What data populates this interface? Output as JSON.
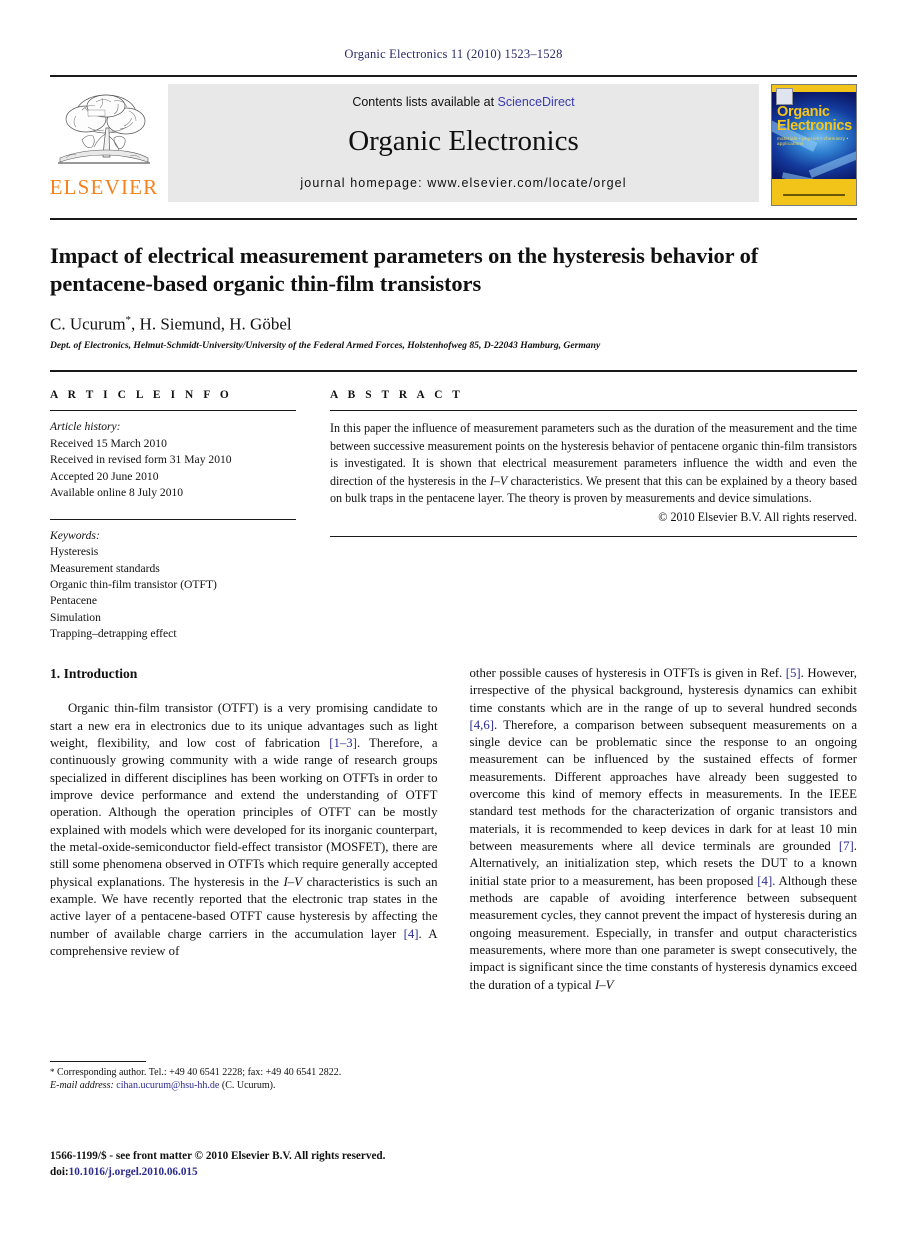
{
  "running_head": "Organic Electronics 11 (2010) 1523–1528",
  "masthead": {
    "publisher_name": "ELSEVIER",
    "contents_prefix": "Contents lists available at ",
    "sciencedirect": "ScienceDirect",
    "journal_title": "Organic Electronics",
    "homepage": "journal homepage: www.elsevier.com/locate/orgel",
    "cover": {
      "title_line1": "Organic",
      "title_line2": "Electronics",
      "subtitle": "materials • physics • chemistry • applications"
    }
  },
  "article": {
    "title": "Impact of electrical measurement parameters on the hysteresis behavior of pentacene-based organic thin-film transistors",
    "authors": "C. Ucurum",
    "authors_rest": ", H. Siemund, H. Göbel",
    "author_marker": "*",
    "affiliation": "Dept. of Electronics, Helmut-Schmidt-University/University of the Federal Armed Forces, Holstenhofweg 85, D-22043 Hamburg, Germany"
  },
  "info": {
    "heading": "A R T I C L E  I N F O",
    "history_label": "Article history:",
    "history": [
      "Received 15 March 2010",
      "Received in revised form 31 May 2010",
      "Accepted 20 June 2010",
      "Available online 8 July 2010"
    ],
    "keywords_label": "Keywords:",
    "keywords": [
      "Hysteresis",
      "Measurement standards",
      "Organic thin-film transistor (OTFT)",
      "Pentacene",
      "Simulation",
      "Trapping–detrapping effect"
    ]
  },
  "abstract": {
    "heading": "A B S T R A C T",
    "part1": "In this paper the influence of measurement parameters such as the duration of the measurement and the time between successive measurement points on the hysteresis behavior of pentacene organic thin-film transistors is investigated. It is shown that electrical measurement parameters influence the width and even the direction of the hysteresis in the ",
    "iv": "I–V",
    "part2": " characteristics. We present that this can be explained by a theory based on bulk traps in the pentacene layer. The theory is proven by measurements and device simulations.",
    "copyright": "© 2010 Elsevier B.V. All rights reserved."
  },
  "body": {
    "section_title": "1. Introduction",
    "left": {
      "p1_a": "Organic thin-film transistor (OTFT) is a very promising candidate to start a new era in electronics due to its unique advantages such as light weight, flexibility, and low cost of fabrication ",
      "ref1": "[1–3]",
      "p1_b": ". Therefore, a continuously growing community with a wide range of research groups specialized in different disciplines has been working on OTFTs in order to improve device performance and extend the understanding of OTFT operation. Although the operation principles of OTFT can be mostly explained with models which were developed for its inorganic counterpart, the metal-oxide-semiconductor field-effect transistor (MOSFET), there are still some phenomena observed in OTFTs which require generally accepted physical explanations. The hysteresis in the ",
      "iv1": "I–V",
      "p1_c": " characteristics is such an example. We have recently reported that the electronic trap states in the active layer of a pentacene-based OTFT cause hysteresis by affecting the number of available charge carriers in the accumulation layer ",
      "ref2": "[4]",
      "p1_d": ". A comprehensive review of"
    },
    "right": {
      "p_a": "other possible causes of hysteresis in OTFTs is given in Ref. ",
      "ref1": "[5]",
      "p_b": ". However, irrespective of the physical background, hysteresis dynamics can exhibit time constants which are in the range of up to several hundred seconds ",
      "ref2": "[4,6]",
      "p_c": ". Therefore, a comparison between subsequent measurements on a single device can be problematic since the response to an ongoing measurement can be influenced by the sustained effects of former measurements. Different approaches have already been suggested to overcome this kind of memory effects in measurements. In the IEEE standard test methods for the characterization of organic transistors and materials, it is recommended to keep devices in dark for at least 10 min between measurements where all device terminals are grounded ",
      "ref3": "[7]",
      "p_d": ". Alternatively, an initialization step, which resets the DUT to a known initial state prior to a measurement, has been proposed ",
      "ref4": "[4]",
      "p_e": ". Although these methods are capable of avoiding interference between subsequent measurement cycles, they cannot prevent the impact of hysteresis during an ongoing measurement. Especially, in transfer and output characteristics measurements, where more than one parameter is swept consecutively, the impact is significant since the time constants of hysteresis dynamics exceed the duration of a typical ",
      "iv1": "I–V"
    }
  },
  "footnote": {
    "marker": "*",
    "text": " Corresponding author. Tel.: +49 40 6541 2228; fax: +49 40 6541 2822.",
    "email_label": "E-mail address:",
    "email": "cihan.ucurum@hsu-hh.de",
    "email_suffix": " (C. Ucurum)."
  },
  "page_footer": {
    "front_matter": "1566-1199/$ - see front matter © 2010 Elsevier B.V. All rights reserved.",
    "doi_label": "doi:",
    "doi": "10.1016/j.orgel.2010.06.015"
  }
}
